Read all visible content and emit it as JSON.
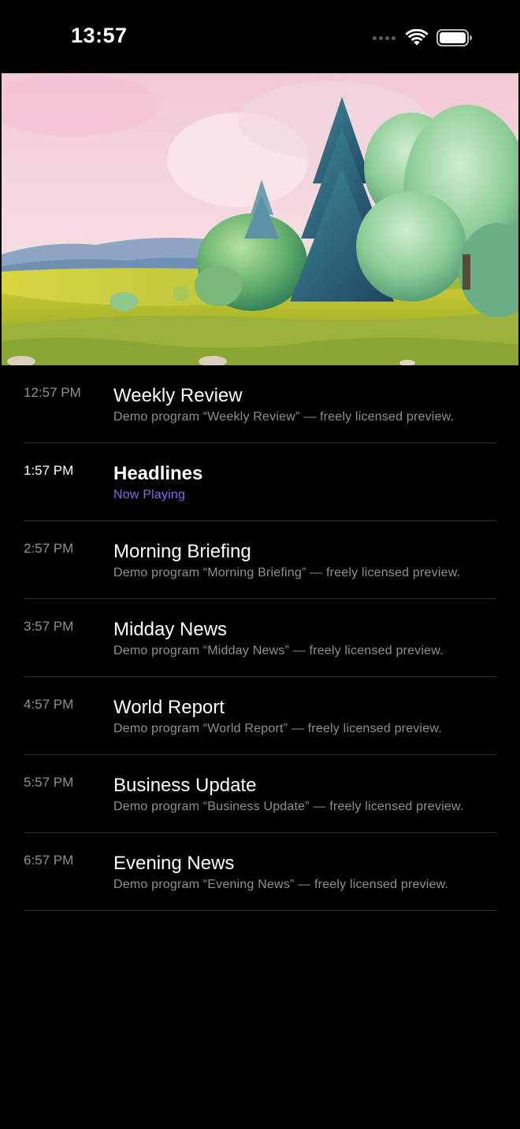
{
  "status_bar": {
    "time": "13:57",
    "icons": [
      "cellular-signal-icon",
      "wifi-icon",
      "battery-icon"
    ]
  },
  "player": {
    "content": "landscape-video-frame"
  },
  "colors": {
    "background": "#000000",
    "accent": "#7c6cf0",
    "secondary_text": "#8e8e93",
    "divider": "#2f2f2f"
  },
  "programs": [
    {
      "time": "12:57 PM",
      "title": "Weekly Review",
      "subtitle": "Demo program “Weekly Review” — freely licensed preview.",
      "live": false
    },
    {
      "time": "1:57 PM",
      "title": "Headlines",
      "subtitle": "Now Playing",
      "live": true
    },
    {
      "time": "2:57 PM",
      "title": "Morning Briefing",
      "subtitle": "Demo program “Morning Briefing” — freely licensed preview.",
      "live": false
    },
    {
      "time": "3:57 PM",
      "title": "Midday News",
      "subtitle": "Demo program “Midday News” — freely licensed preview.",
      "live": false
    },
    {
      "time": "4:57 PM",
      "title": "World Report",
      "subtitle": "Demo program “World Report” — freely licensed preview.",
      "live": false
    },
    {
      "time": "5:57 PM",
      "title": "Business Update",
      "subtitle": "Demo program “Business Update” — freely licensed preview.",
      "live": false
    },
    {
      "time": "6:57 PM",
      "title": "Evening News",
      "subtitle": "Demo program “Evening News” — freely licensed preview.",
      "live": false
    }
  ]
}
